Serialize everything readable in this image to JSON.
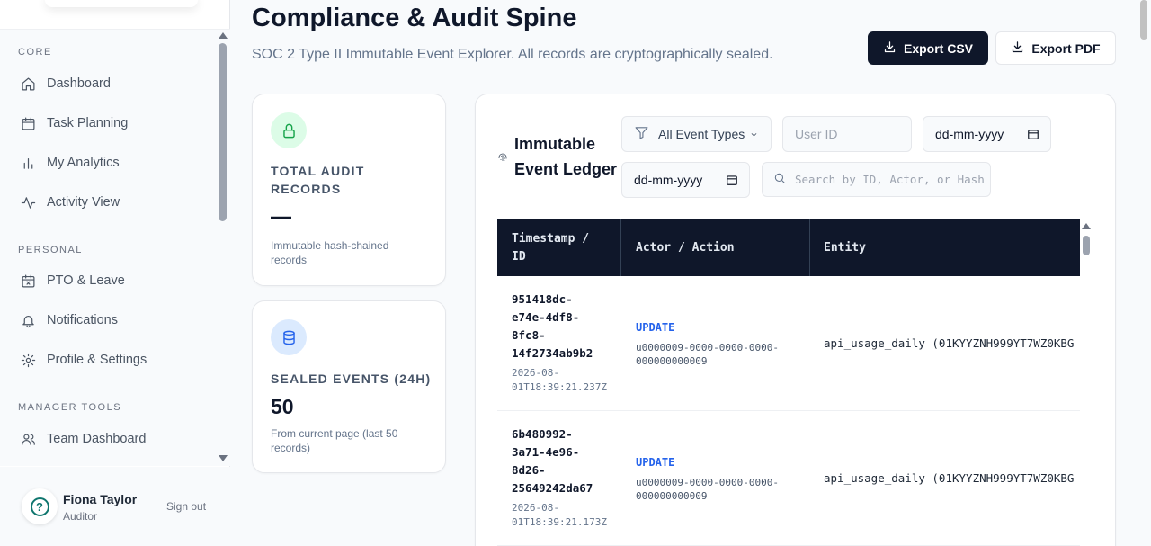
{
  "sidebar": {
    "sections": [
      {
        "label": "CORE"
      },
      {
        "label": "PERSONAL"
      },
      {
        "label": "MANAGER TOOLS"
      }
    ],
    "items": [
      {
        "label": "Dashboard",
        "icon": "home-icon"
      },
      {
        "label": "Task Planning",
        "icon": "calendar-icon"
      },
      {
        "label": "My Analytics",
        "icon": "bar-chart-icon"
      },
      {
        "label": "Activity View",
        "icon": "activity-icon"
      },
      {
        "label": "PTO & Leave",
        "icon": "calendar-x-icon"
      },
      {
        "label": "Notifications",
        "icon": "bell-icon"
      },
      {
        "label": "Profile & Settings",
        "icon": "gear-icon"
      },
      {
        "label": "Team Dashboard",
        "icon": "users-icon"
      }
    ],
    "user": {
      "name": "Fiona Taylor",
      "role": "Auditor",
      "sign_out": "Sign out",
      "avatar_icon": "help-circle-icon"
    }
  },
  "header": {
    "title": "Compliance & Audit Spine",
    "subtitle": "SOC 2 Type II Immutable Event Explorer. All records are cryptographically sealed.",
    "export_csv": "Export CSV",
    "export_pdf": "Export PDF"
  },
  "stats": {
    "total": {
      "label_line1": "TOTAL AUDIT",
      "label_line2": "RECORDS",
      "value": "—",
      "desc_line1": "Immutable hash-chained",
      "desc_line2": "records",
      "icon": "lock-icon",
      "icon_bg": "#dcfce7",
      "icon_color": "#16a34a"
    },
    "sealed": {
      "label": "SEALED EVENTS (24H)",
      "value": "50",
      "desc_line1": "From current page (last 50",
      "desc_line2": "records)",
      "icon": "database-icon",
      "icon_bg": "#dbeafe",
      "icon_color": "#2563eb"
    }
  },
  "ledger": {
    "title_line1": "Immutable",
    "title_line2": "Event Ledger",
    "title_icon": "fingerprint-icon",
    "filters": {
      "event_type": "All Event Types",
      "user_id_placeholder": "User ID",
      "date_from": "dd-mm-yyyy",
      "date_to": "dd-mm-yyyy",
      "search_placeholder": "Search by ID, Actor, or Hash"
    },
    "columns": {
      "col1_line1": "Timestamp /",
      "col1_line2": "ID",
      "col2": "Actor / Action",
      "col3": "Entity"
    },
    "rows": [
      {
        "id_lines": [
          "951418dc-",
          "e74e-4df8-",
          "8fc8-",
          "14f2734ab9b2"
        ],
        "ts_lines": [
          "2026-08-",
          "01T18:39:21.237Z"
        ],
        "action": "UPDATE",
        "actor_lines": [
          "u0000009-0000-0000-0000-",
          "000000000009"
        ],
        "entity": "api_usage_daily (01KYYZNH999YT7WZ0KBG"
      },
      {
        "id_lines": [
          "6b480992-",
          "3a71-4e96-",
          "8d26-",
          "25649242da67"
        ],
        "ts_lines": [
          "2026-08-",
          "01T18:39:21.173Z"
        ],
        "action": "UPDATE",
        "actor_lines": [
          "u0000009-0000-0000-0000-",
          "000000000009"
        ],
        "entity": "api_usage_daily (01KYYZNH999YT7WZ0KBG"
      }
    ]
  }
}
